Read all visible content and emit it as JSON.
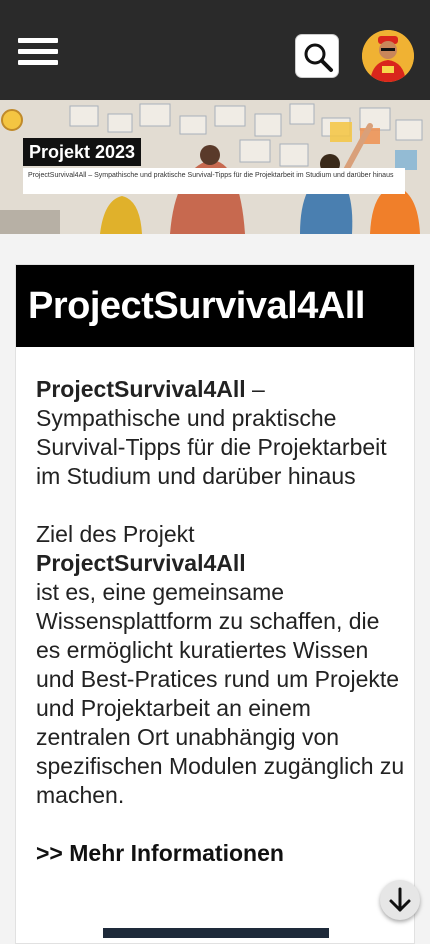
{
  "header": {
    "menu_icon": "hamburger-menu-icon",
    "search_icon": "search-icon",
    "avatar_icon": "user-avatar"
  },
  "hero": {
    "badge": "Projekt 2023",
    "subtitle": "ProjectSurvival4All – Sympathische und praktische Survival-Tipps für die Projektarbeit im Studium und darüber hinaus"
  },
  "card": {
    "title": "ProjectSurvival4All",
    "intro_bold": "ProjectSurvival4All",
    "intro_rest": " – Sympathische und praktische Survival-Tipps für die Projektarbeit im Studium und darüber hinaus",
    "para_pre": "Ziel des Projekt ",
    "para_bold": "ProjectSurvival4All",
    "para_post": " ist es, eine gemeinsame Wissensplattform zu schaffen, die es ermöglicht kuratiertes Wissen und Best-Pratices rund um Projekte und Projektarbeit an einem zentralen Ort unabhängig von spezifischen Modulen zugänglich zu machen.",
    "more_link": ">> Mehr Informationen"
  },
  "scroll_icon": "arrow-down-icon"
}
